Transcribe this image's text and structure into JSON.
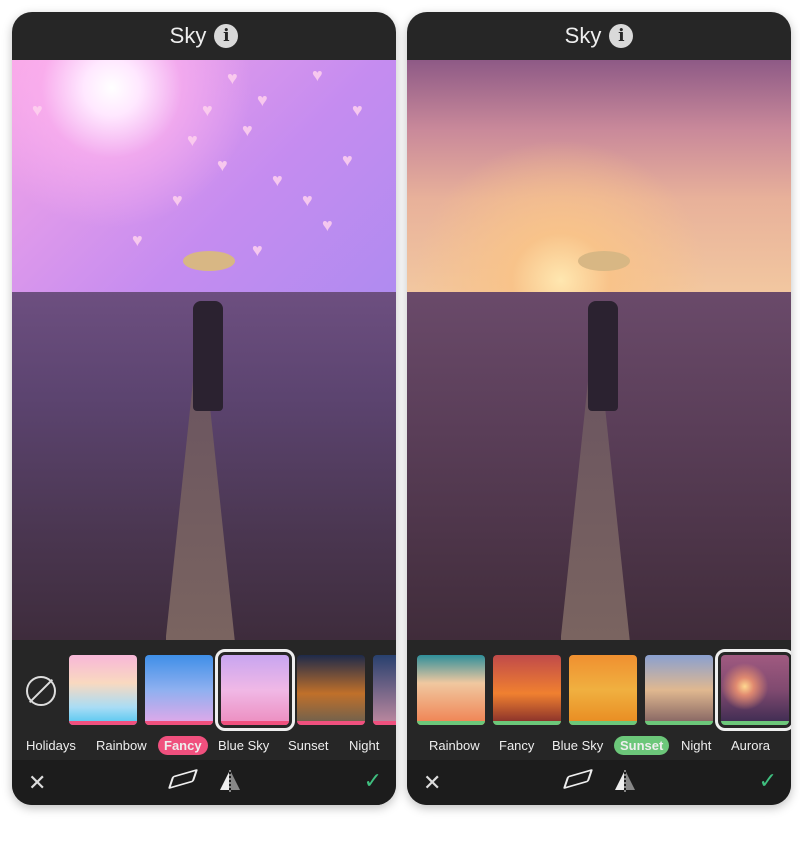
{
  "colors": {
    "left_accent": "#f0507e",
    "right_accent": "#6cc77a",
    "check": "#3fbf7f"
  },
  "left": {
    "title": "Sky",
    "filters": [
      "Holidays",
      "Rainbow",
      "Fancy",
      "Blue Sky",
      "Sunset",
      "Night"
    ],
    "selected_category": "Fancy",
    "selected_thumbnail": 3
  },
  "right": {
    "title": "Sky",
    "filters": [
      "Rainbow",
      "Fancy",
      "Blue Sky",
      "Sunset",
      "Night",
      "Aurora"
    ],
    "selected_category": "Sunset",
    "selected_thumbnail": 5
  },
  "icons": {
    "info": "info-icon",
    "none": "no-filter-icon",
    "close": "close-icon",
    "eraser": "eraser-icon",
    "flip": "flip-icon",
    "confirm": "checkmark-icon"
  }
}
